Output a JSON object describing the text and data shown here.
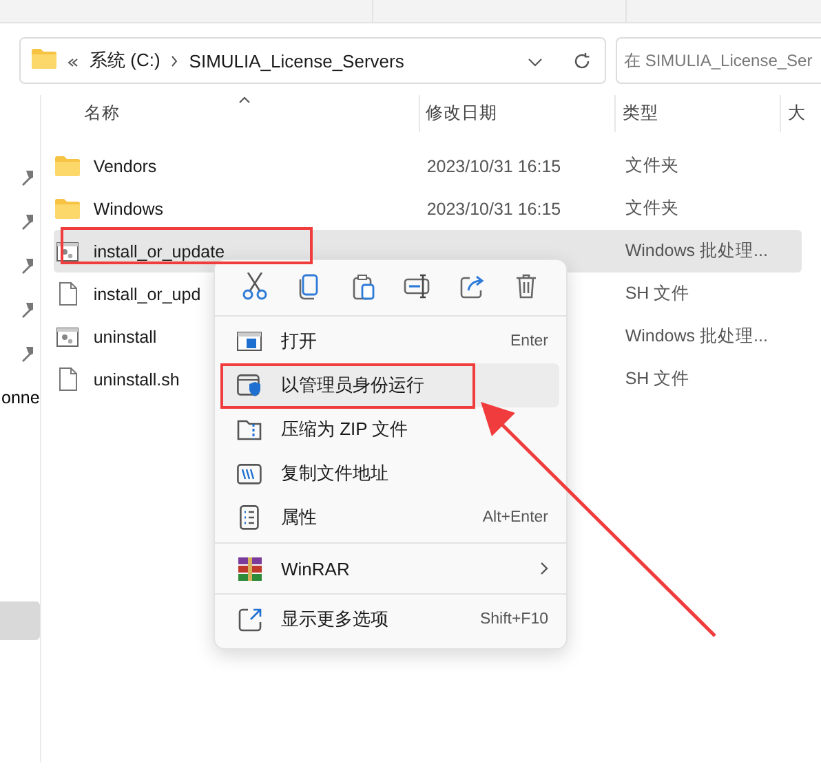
{
  "address_bar": {
    "crumbs": [
      "系统 (C:)",
      "SIMULIA_License_Servers"
    ]
  },
  "search": {
    "placeholder": "在 SIMULIA_License_Ser"
  },
  "sidebar": {
    "items": [
      {
        "kind": "pinned",
        "selected": false
      },
      {
        "kind": "pinned",
        "selected": false
      },
      {
        "kind": "pinned",
        "selected": false
      },
      {
        "kind": "pinned",
        "selected": false
      },
      {
        "kind": "pinned",
        "selected": false
      },
      {
        "kind": "label",
        "label": "onne",
        "selected": false
      },
      {
        "kind": "blank",
        "selected": true
      }
    ]
  },
  "columns": [
    "名称",
    "修改日期",
    "类型",
    "大"
  ],
  "rows": [
    {
      "kind": "folder",
      "name": "Vendors",
      "date": "2023/10/31 16:15",
      "type": "文件夹",
      "selected": false
    },
    {
      "kind": "folder",
      "name": "Windows",
      "date": "2023/10/31 16:15",
      "type": "文件夹",
      "selected": false
    },
    {
      "kind": "batch",
      "name": "install_or_update",
      "type": "Windows 批处理...",
      "selected": true
    },
    {
      "kind": "file",
      "name": "install_or_upd",
      "type": "SH 文件",
      "selected": false
    },
    {
      "kind": "batch",
      "name": "uninstall",
      "type": "Windows 批处理...",
      "selected": false
    },
    {
      "kind": "file",
      "name": "uninstall.sh",
      "type": "SH 文件",
      "selected": false
    }
  ],
  "context_menu": {
    "items": [
      {
        "kind": "item",
        "label": "打开",
        "shortcut": "Enter",
        "selected": false
      },
      {
        "kind": "item",
        "label": "以管理员身份运行",
        "selected": true
      },
      {
        "kind": "item",
        "label": "压缩为 ZIP 文件",
        "selected": false
      },
      {
        "kind": "item",
        "label": "复制文件地址",
        "selected": false
      },
      {
        "kind": "item",
        "label": "属性",
        "shortcut": "Alt+Enter",
        "selected": false
      },
      {
        "kind": "submenu",
        "label": "WinRAR",
        "selected": false
      },
      {
        "kind": "item",
        "label": "显示更多选项",
        "shortcut": "Shift+F10",
        "selected": false
      }
    ]
  },
  "annotations": [
    {
      "kind": "box"
    },
    {
      "kind": "box"
    },
    {
      "kind": "arrow"
    }
  ]
}
